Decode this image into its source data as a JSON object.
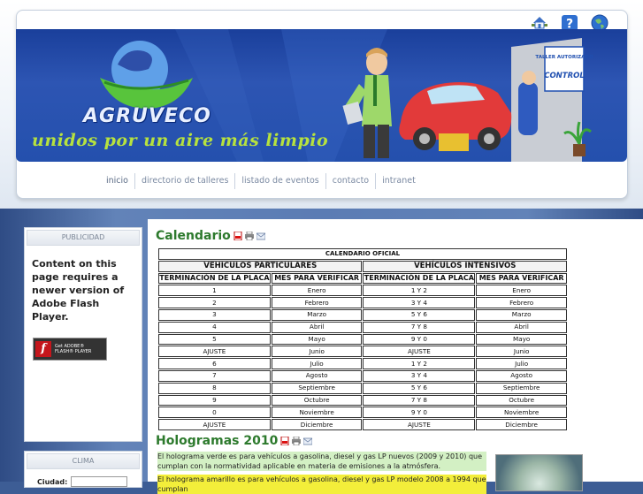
{
  "header": {
    "brand": "AGRUVECO",
    "slogan": "unidos por un aire más limpio",
    "sign_top": "TALLER AUTORIZADO",
    "sign_main": "CONTROL",
    "icons": [
      "home-icon",
      "help-icon",
      "globe-icon"
    ]
  },
  "nav": {
    "items": [
      "inicio",
      "directorio de talleres",
      "listado de eventos",
      "contacto",
      "intranet"
    ]
  },
  "sidebar": {
    "publicidad_title": "PUBLICIDAD",
    "flash_message": "Content on this page requires a newer version of Adobe Flash Player.",
    "flash_button_line1": "Get ADOBE®",
    "flash_button_line2": "FLASH® PLAYER",
    "clima_title": "CLIMA",
    "ciudad_label": "Ciudad:"
  },
  "calendario": {
    "title": "Calendario",
    "table_title": "CALENDARIO OFICIAL",
    "group_left": "VEHICULOS PARTICULARES",
    "group_right": "VEHÍCULOS INTENSIVOS",
    "col_headers": [
      "TERMINACIÓN DE LA PLACA",
      "MES PARA VERIFICAR",
      "TERMINACIÓN DE LA PLACA",
      "MES PARA VERIFICAR"
    ],
    "rows": [
      [
        "1",
        "Enero",
        "1 Y 2",
        "Enero"
      ],
      [
        "2",
        "Febrero",
        "3 Y 4",
        "Febrero"
      ],
      [
        "3",
        "Marzo",
        "5 Y 6",
        "Marzo"
      ],
      [
        "4",
        "Abril",
        "7 Y 8",
        "Abril"
      ],
      [
        "5",
        "Mayo",
        "9 Y 0",
        "Mayo"
      ],
      [
        "AJUSTE",
        "Junio",
        "AJUSTE",
        "Junio"
      ],
      [
        "6",
        "Julio",
        "1 Y 2",
        "Julio"
      ],
      [
        "7",
        "Agosto",
        "3 Y 4",
        "Agosto"
      ],
      [
        "8",
        "Septiembre",
        "5 Y 6",
        "Septiembre"
      ],
      [
        "9",
        "Octubre",
        "7 Y 8",
        "Octubre"
      ],
      [
        "0",
        "Noviembre",
        "9 Y 0",
        "Noviembre"
      ],
      [
        "AJUSTE",
        "Diciembre",
        "AJUSTE",
        "Diciembre"
      ]
    ]
  },
  "hologramas": {
    "title": "Hologramas 2010",
    "para1": "El holograma verde es para vehículos a gasolina, diesel y gas LP nuevos (2009 y 2010) que cumplan con la normatividad aplicable en materia de emisiones a la atmósfera.",
    "para2": "El holograma amarillo es para vehículos a gasolina, diesel y gas LP modelo 2008 a 1994 que cumplan"
  },
  "colors": {
    "banner_blue": "#2450ad",
    "slogan_green": "#b7e23e",
    "title_green": "#2d7a2d"
  }
}
